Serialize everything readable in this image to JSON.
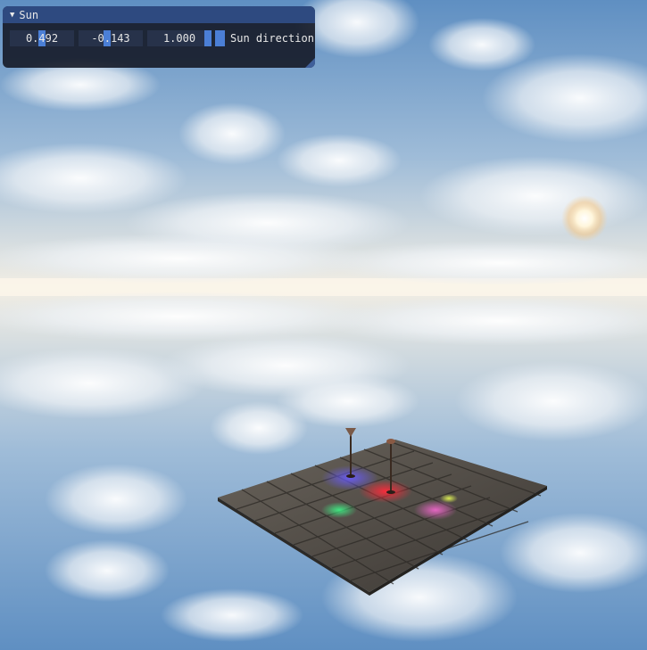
{
  "panel": {
    "title": "Sun",
    "collapse_icon": "triangle-down-icon",
    "fields": [
      {
        "value": "0.492",
        "grab": 0.5
      },
      {
        "value": "-0.143",
        "grab": 0.43
      },
      {
        "value": "1.000",
        "grab": 1.0
      }
    ],
    "label": "Sun direction",
    "accent_color": "#4b7fd6",
    "title_bar_color": "#2e4a80"
  }
}
